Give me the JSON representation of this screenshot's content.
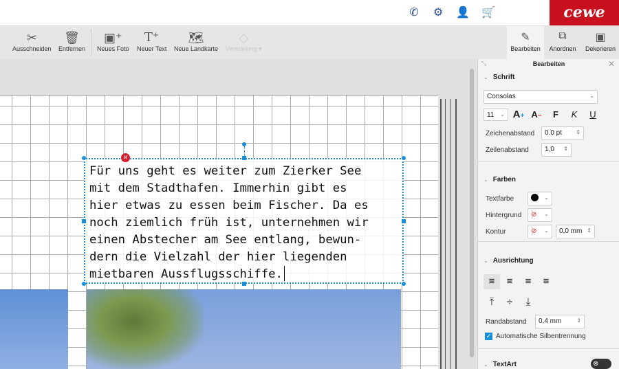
{
  "header": {
    "logo": "cewe",
    "icons": [
      "phone-icon",
      "settings-icon",
      "user-icon",
      "cart-icon"
    ]
  },
  "toolbar": {
    "items": [
      {
        "label": "Ausschneiden",
        "icon": "scissors-icon"
      },
      {
        "label": "Entfernen",
        "icon": "trash-icon"
      },
      {
        "label": "Neues Foto",
        "icon": "add-photo-icon"
      },
      {
        "label": "Neuer Text",
        "icon": "add-text-icon"
      },
      {
        "label": "Neue Landkarte",
        "icon": "add-map-icon"
      },
      {
        "label": "Veredelung",
        "icon": "diamond-icon",
        "disabled": true
      }
    ]
  },
  "panel_tabs": [
    {
      "label": "Bearbeiten"
    },
    {
      "label": "Anordnen"
    },
    {
      "label": "Dekorieren"
    }
  ],
  "panel": {
    "title": "Bearbeiten",
    "schrift": {
      "heading": "Schrift",
      "font": "Consolas",
      "size": "11",
      "bold": "F",
      "italic": "K",
      "underline": "U",
      "char_spacing_label": "Zeichenabstand",
      "char_spacing": "0.0 pt",
      "line_spacing_label": "Zeilenabstand",
      "line_spacing": "1,0"
    },
    "farben": {
      "heading": "Farben",
      "text_color_label": "Textfarbe",
      "text_color": "#000000",
      "background_label": "Hintergrund",
      "contour_label": "Kontur",
      "contour_width": "0,0 mm"
    },
    "ausrichtung": {
      "heading": "Ausrichtung",
      "margin_label": "Randabstand",
      "margin": "0,4 mm",
      "hyphenation_label": "Automatische Silbentrennung",
      "hyphenation": true
    },
    "textart": {
      "heading": "TextArt",
      "enabled": false
    }
  },
  "editor": {
    "text_lines": [
      "Für uns geht es weiter zum Zierker See",
      "mit dem Stadthafen. Immerhin gibt es",
      "hier etwas zu essen beim Fischer. Da es",
      "noch ziemlich früh ist, unternehmen wir",
      "einen Abstecher am See entlang, bewun-",
      "dern die Vielzahl der hier liegenden",
      "mietbaren Aussflugsschiffe."
    ]
  }
}
